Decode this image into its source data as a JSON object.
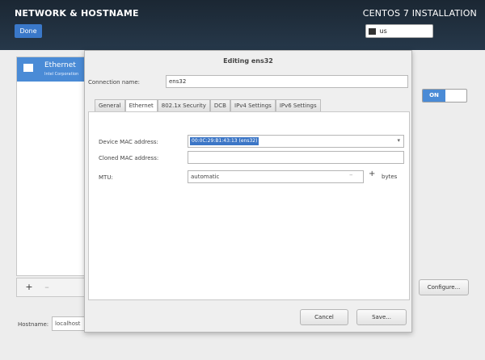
{
  "header": {
    "spoke_title": "NETWORK & HOSTNAME",
    "done_label": "Done",
    "product_title": "CENTOS 7 INSTALLATION",
    "keyboard_layout": "us"
  },
  "devices": {
    "items": [
      {
        "name": "Ethernet",
        "subtitle": "Intel Corporation"
      }
    ],
    "add_label": "+",
    "remove_label": "–"
  },
  "hostname": {
    "label": "Hostname:",
    "value": "localhost"
  },
  "device_toggle": {
    "state_label": "ON"
  },
  "configure_label": "Configure...",
  "dialog": {
    "title": "Editing ens32",
    "connection_name_label": "Connection name:",
    "connection_name_value": "ens32",
    "tabs": [
      "General",
      "Ethernet",
      "802.1x Security",
      "DCB",
      "IPv4 Settings",
      "IPv6 Settings"
    ],
    "active_tab": "Ethernet",
    "ethernet": {
      "device_mac_label": "Device MAC address:",
      "device_mac_value": "00:0C:29:B1:43:13 (ens32)",
      "cloned_mac_label": "Cloned MAC address:",
      "cloned_mac_value": "",
      "mtu_label": "MTU:",
      "mtu_value": "automatic",
      "mtu_minus": "–",
      "mtu_plus": "+",
      "mtu_unit": "bytes"
    },
    "cancel_label": "Cancel",
    "save_label": "Save..."
  },
  "colors": {
    "header_bg": "#1b2733",
    "accent": "#4a8bd6",
    "selection": "#3c76c6"
  }
}
